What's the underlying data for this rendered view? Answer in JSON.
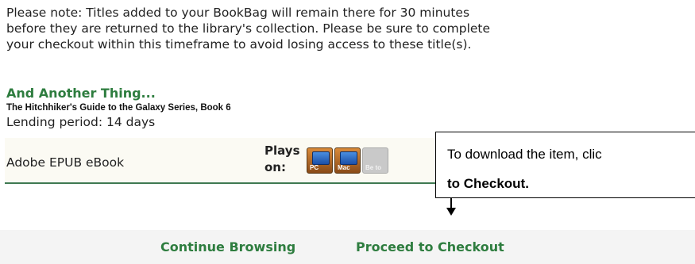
{
  "notice": {
    "line1": "Please note: Titles added to your BookBag will remain there for 30 minutes",
    "line2": "before they are returned to the library's collection. Please be sure to complete",
    "line3": "your checkout within this timeframe to avoid losing access to these title(s)."
  },
  "book": {
    "title": "And Another Thing...",
    "series": "The Hitchhiker's Guide to the Galaxy Series, Book 6",
    "lending_period": "Lending period: 14 days"
  },
  "format": {
    "name": "Adobe EPUB eBook",
    "plays_on_label": "Plays on:",
    "devices": [
      {
        "label": "PC",
        "icon": "pc-icon"
      },
      {
        "label": "Mac",
        "icon": "mac-icon"
      },
      {
        "label": "Be to",
        "icon": "disabled-device-icon"
      }
    ]
  },
  "tooltip": {
    "line1": "To download the item, clic",
    "line2": "to Checkout."
  },
  "actions": {
    "continue_label": "Continue Browsing",
    "checkout_label": "Proceed to Checkout"
  },
  "colors": {
    "link_green": "#2e7d3f",
    "divider_green": "#3f7a52",
    "device_orange": "#d98a3a"
  }
}
